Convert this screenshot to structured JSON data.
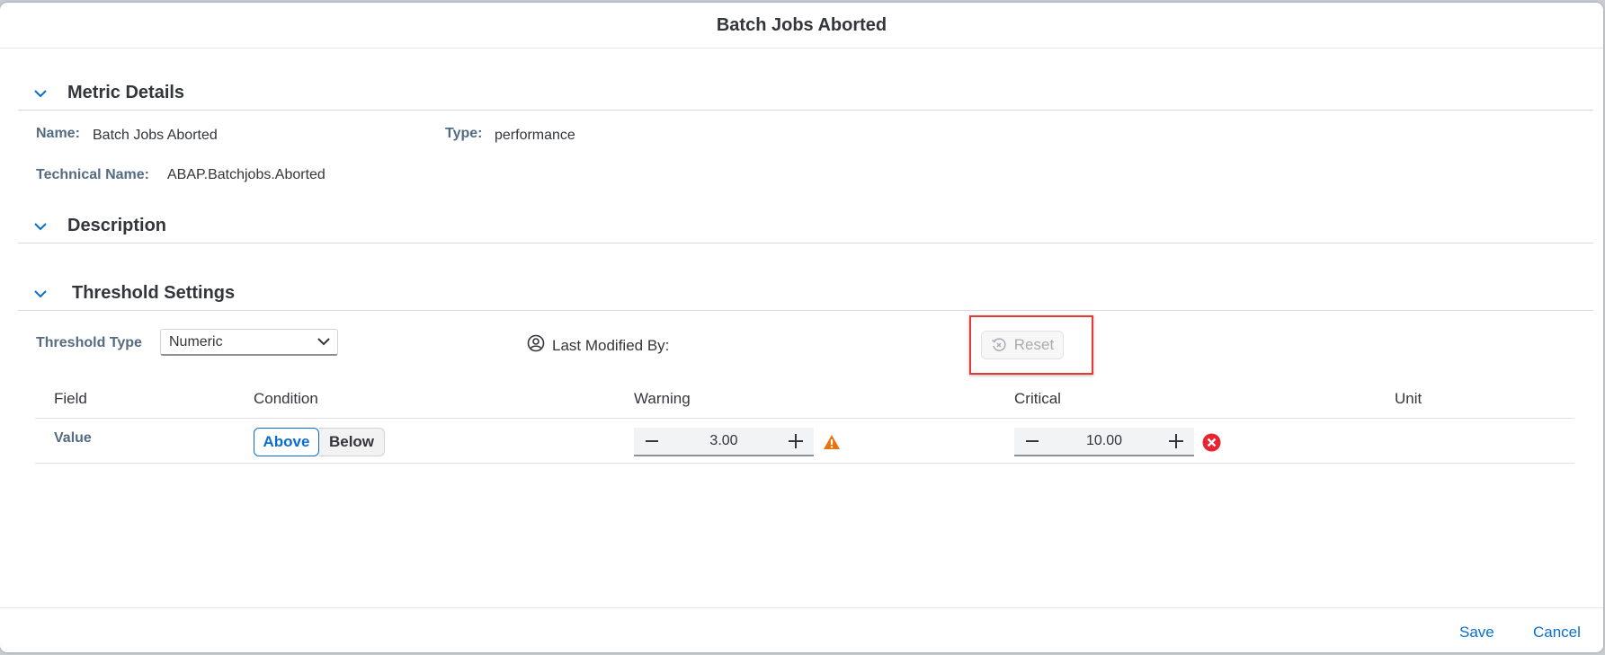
{
  "dialog": {
    "title": "Batch Jobs Aborted"
  },
  "sections": {
    "metric_details": {
      "title": "Metric Details"
    },
    "description": {
      "title": "Description"
    },
    "threshold_settings": {
      "title": "Threshold Settings"
    }
  },
  "metric": {
    "name_label": "Name:",
    "name_value": "Batch Jobs Aborted",
    "type_label": "Type:",
    "type_value": "performance",
    "technical_name_label": "Technical Name:",
    "technical_name_value": "ABAP.Batchjobs.Aborted"
  },
  "threshold": {
    "type_label": "Threshold Type",
    "type_value": "Numeric",
    "last_modified_label": "Last Modified By:",
    "reset_label": "Reset",
    "columns": [
      "Field",
      "Condition",
      "Warning",
      "Critical",
      "Unit"
    ],
    "rows": [
      {
        "field": "Value",
        "condition_options": [
          "Above",
          "Below"
        ],
        "condition_selected": "Above",
        "warning": "3.00",
        "critical": "10.00",
        "unit": ""
      }
    ]
  },
  "footer": {
    "save_label": "Save",
    "cancel_label": "Cancel"
  },
  "colors": {
    "accent": "#0a6ed1",
    "warning": "#e9730c",
    "critical": "#e8242f",
    "highlight": "#e53935"
  },
  "icons": {
    "collapse": "chevron-down-icon",
    "user": "user-circle-icon",
    "reset": "reset-icon",
    "warning": "warning-triangle-icon",
    "critical": "error-circle-icon",
    "minus": "minus-icon",
    "plus": "plus-icon"
  }
}
